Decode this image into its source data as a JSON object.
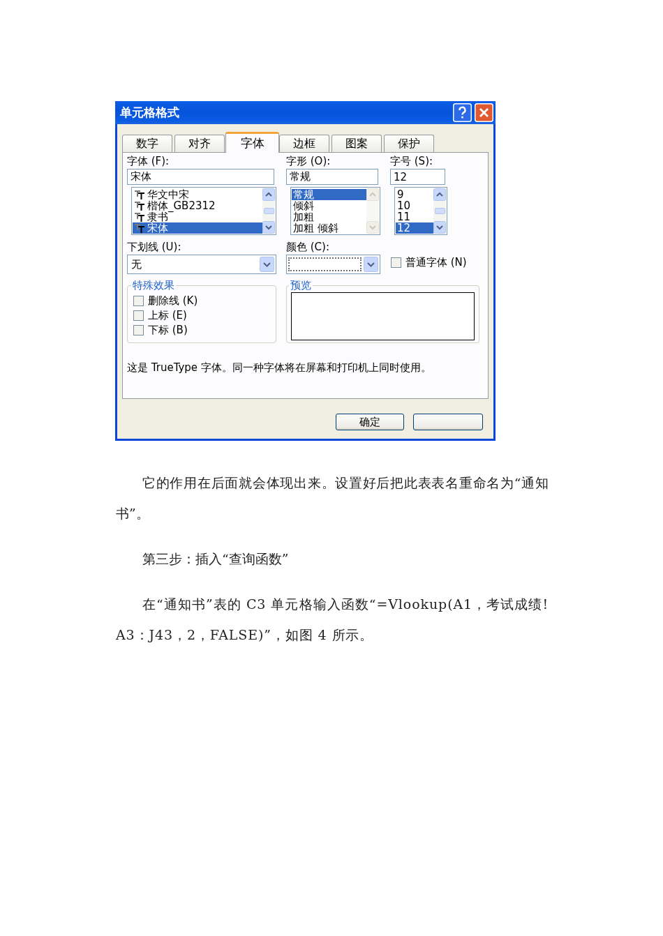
{
  "dialog": {
    "title": "单元格格式",
    "title_buttons": [
      {
        "kind": "help"
      },
      {
        "kind": "close"
      }
    ],
    "tabs": [
      {
        "label": "数字",
        "selected": false
      },
      {
        "label": "对齐",
        "selected": false
      },
      {
        "label": "字体",
        "selected": true
      },
      {
        "label": "边框",
        "selected": false
      },
      {
        "label": "图案",
        "selected": false
      },
      {
        "label": "保护",
        "selected": false
      }
    ],
    "lists": [
      {
        "kind": "font",
        "label": "字体 (F):",
        "value": "宋体",
        "scroll_disabled": false,
        "items": [
          {
            "label": "华文中宋",
            "selected": false
          },
          {
            "label": "楷体_GB2312",
            "selected": false
          },
          {
            "label": "隶书",
            "selected": false
          },
          {
            "label": "宋体",
            "selected": true
          }
        ]
      },
      {
        "kind": "text",
        "label": "字形 (O):",
        "value": "常规",
        "scroll_disabled": true,
        "items": [
          {
            "label": "常规",
            "selected": true
          },
          {
            "label": "倾斜",
            "selected": false
          },
          {
            "label": "加粗",
            "selected": false
          },
          {
            "label": "加粗 倾斜",
            "selected": false
          }
        ]
      },
      {
        "kind": "text",
        "label": "字号 (S):",
        "value": "12",
        "scroll_disabled": false,
        "items": [
          {
            "label": "9",
            "selected": false
          },
          {
            "label": "10",
            "selected": false
          },
          {
            "label": "11",
            "selected": false
          },
          {
            "label": "12",
            "selected": true
          }
        ]
      }
    ],
    "underline": {
      "label": "下划线 (U):",
      "value": "无"
    },
    "color": {
      "label": "颜色 (C):"
    },
    "normal_font": {
      "label": "普通字体 (N)",
      "checked": false
    },
    "effects": {
      "title": "特殊效果",
      "items": [
        {
          "label": "删除线 (K)",
          "checked": false
        },
        {
          "label": "上标 (E)",
          "checked": false
        },
        {
          "label": "下标 (B)",
          "checked": false
        }
      ]
    },
    "preview": {
      "title": "预览"
    },
    "note": "这是 TrueType 字体。同一种字体将在屏幕和打印机上同时使用。",
    "buttons": [
      {
        "kind": "text",
        "label": "确定"
      },
      {
        "kind": "blank"
      }
    ]
  },
  "paragraphs": [
    "它的作用在后面就会体现出来。设置好后把此表表名重命名为“通知书”。",
    "第三步：插入“查询函数”",
    "在“通知书”表的 C3 单元格输入函数“=Vlookup(A1，考试成绩!A3：J43，2，FALSE)”，如图 4 所示。"
  ]
}
